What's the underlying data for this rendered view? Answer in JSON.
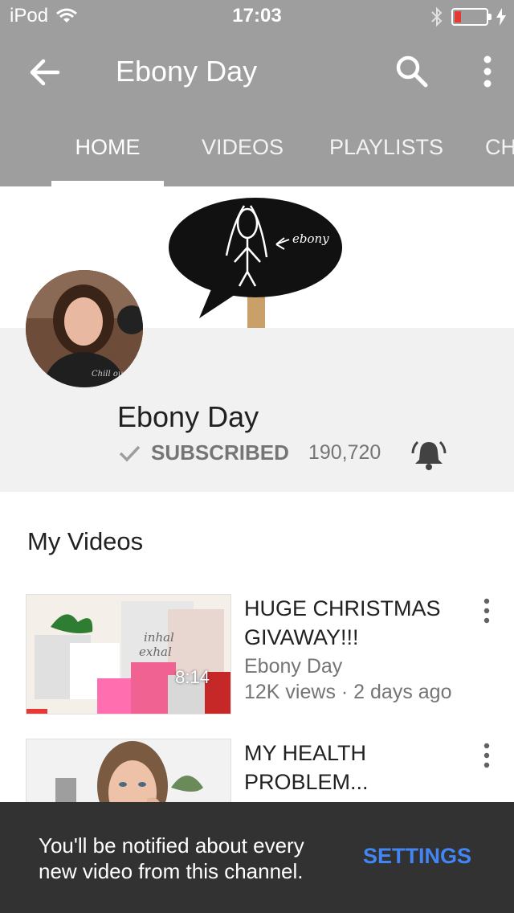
{
  "status_bar": {
    "carrier": "iPod",
    "time": "17:03",
    "battery_level": 0.2,
    "icons": [
      "wifi-icon",
      "bluetooth-icon",
      "battery-icon",
      "charging-icon"
    ]
  },
  "app_bar": {
    "title": "Ebony Day",
    "tabs": [
      {
        "label": "HOME",
        "active": true
      },
      {
        "label": "VIDEOS",
        "active": false
      },
      {
        "label": "PLAYLISTS",
        "active": false
      },
      {
        "label": "CHA",
        "active": false
      }
    ],
    "icons": [
      "back-arrow-icon",
      "search-icon",
      "more-vert-icon"
    ]
  },
  "channel": {
    "name": "Ebony Day",
    "subscribed_label": "SUBSCRIBED",
    "subscriber_count": "190,720",
    "banner_text": "ebony"
  },
  "section": {
    "title": "My Videos"
  },
  "videos": [
    {
      "title": "HUGE CHRISTMAS GIVAWAY!!!",
      "channel": "Ebony Day",
      "meta": "12K views · 2 days ago",
      "duration": "8:14",
      "thumb_text_1": "inhal",
      "thumb_text_2": "exhal"
    },
    {
      "title": "MY HEALTH PROBLEM..."
    }
  ],
  "snackbar": {
    "message": "You'll be notified about every new video from this channel.",
    "action": "SETTINGS"
  },
  "colors": {
    "app_bar": "#9e9e9e",
    "accent_blue": "#4285f4",
    "snackbar": "#323232",
    "progress_red": "#e53935"
  }
}
